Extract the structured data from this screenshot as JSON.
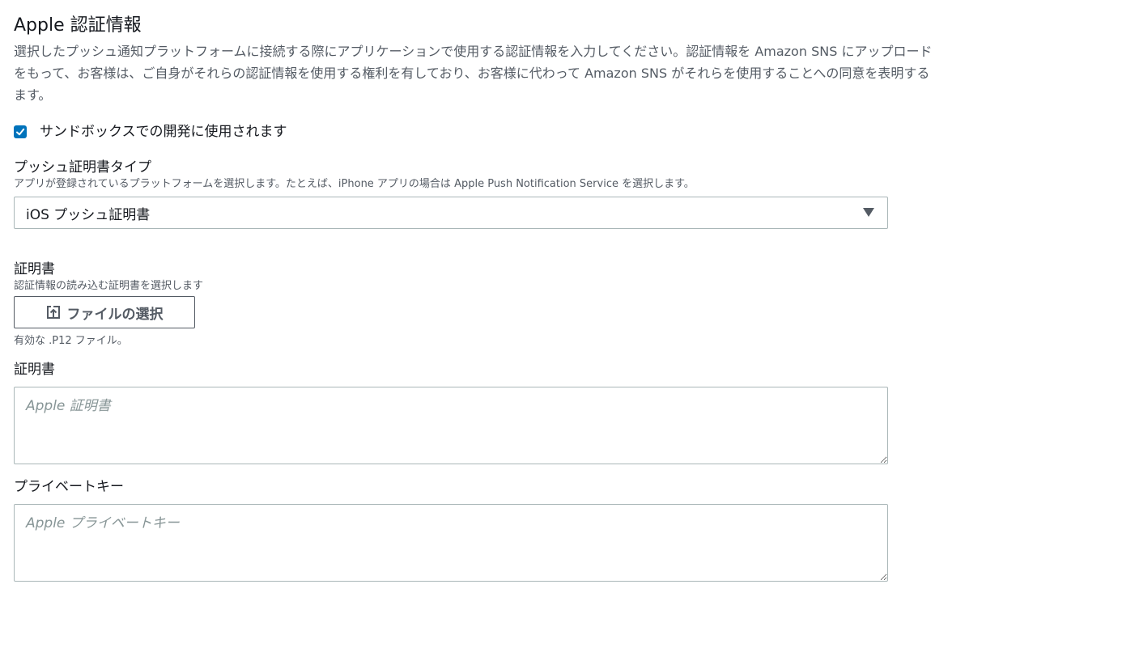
{
  "section": {
    "title": "Apple 認証情報",
    "description_lines": [
      "選択したプッシュ通知プラットフォームに接続する際にアプリケーションで使用する認証情報を入力してください。認証情報を Amazon SNS にアップロード",
      "をもって、お客様は、ご自身がそれらの認証情報を使用する権利を有しており、お客様に代わって Amazon SNS がそれらを使用することへの同意を表明する",
      "ます。"
    ]
  },
  "sandbox": {
    "label": "サンドボックスでの開発に使用されます",
    "checked": true
  },
  "push_cert_type": {
    "label": "プッシュ証明書タイプ",
    "hint": "アプリが登録されているプラットフォームを選択します。たとえば、iPhone アプリの場合は Apple Push Notification Service を選択します。",
    "selected": "iOS プッシュ証明書"
  },
  "certificate_file": {
    "label": "証明書",
    "hint": "認証情報の読み込む証明書を選択します",
    "button_label": "ファイルの選択",
    "constraint": "有効な .P12 ファイル。"
  },
  "certificate": {
    "label": "証明書",
    "placeholder": "Apple 証明書",
    "value": ""
  },
  "private_key": {
    "label": "プライベートキー",
    "placeholder": "Apple プライベートキー",
    "value": ""
  },
  "icons": {
    "checkbox": "checkmark-icon",
    "select": "caret-down-icon",
    "upload": "upload-icon"
  },
  "colors": {
    "accent": "#0073bb",
    "text": "#16191f",
    "secondary_text": "#545b64",
    "border": "#aab7b8",
    "placeholder": "#879596"
  }
}
